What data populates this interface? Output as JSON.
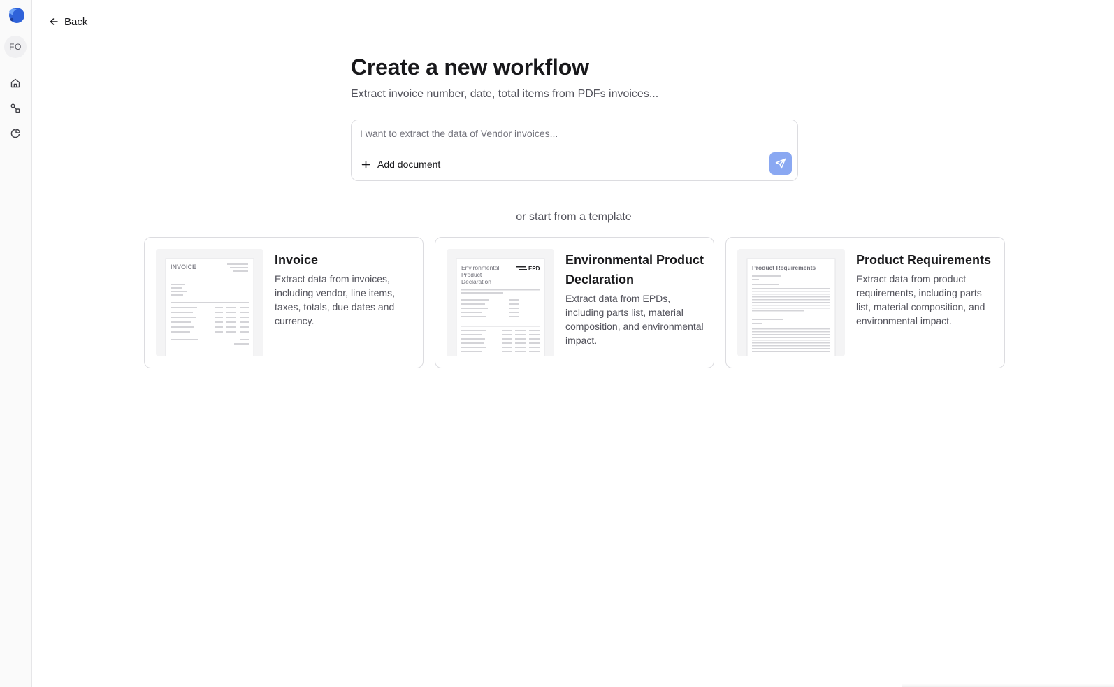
{
  "sidebar": {
    "logo_icon": "company-logo-icon",
    "avatar_initials": "FO",
    "nav": [
      {
        "icon": "home-icon"
      },
      {
        "icon": "workflows-icon"
      },
      {
        "icon": "analytics-icon"
      }
    ]
  },
  "back": {
    "label": "Back",
    "icon": "arrow-left-icon"
  },
  "header": {
    "title": "Create a new workflow",
    "subtitle": "Extract invoice number, date, total items from PDFs invoices..."
  },
  "prompt": {
    "placeholder": "I want to extract the data of Vendor invoices...",
    "value": "",
    "add_document_label": "Add document",
    "send_icon": "send-icon"
  },
  "templates": {
    "heading": "or start from a template",
    "items": [
      {
        "title": "Invoice",
        "description": "Extract data from invoices, including vendor, line items, taxes, totals, due dates and currency.",
        "thumbnail_text": [
          "INVOICE"
        ]
      },
      {
        "title": "Environmental Product Declaration",
        "description": "Extract data from EPDs, including parts list, material composition, and environmental impact.",
        "thumbnail_text": [
          "Environmental",
          "Product",
          "Declaration",
          "EPD"
        ]
      },
      {
        "title": "Product Requirements",
        "description": "Extract data from product requirements, including parts list, material composition, and environmental impact.",
        "thumbnail_text": [
          "Product Requirements"
        ]
      }
    ]
  },
  "colors": {
    "accent": "#2563eb",
    "send_button": "#8aa8f2",
    "sidebar_bg": "#fafafa",
    "border": "#dcdce0"
  }
}
